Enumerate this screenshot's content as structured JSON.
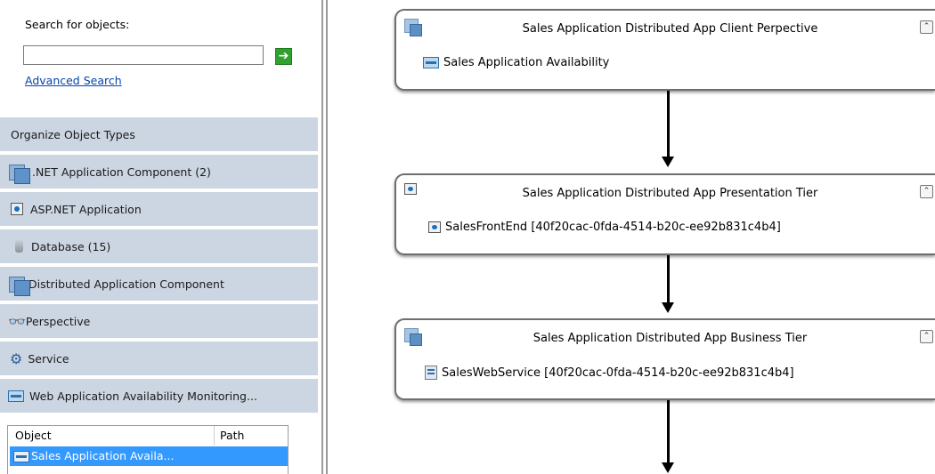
{
  "search": {
    "label": "Search for objects:",
    "value": "",
    "placeholder": "",
    "go_icon": "arrow-right-icon",
    "advanced_link": "Advanced Search"
  },
  "object_types": {
    "header": "Organize Object Types",
    "items": [
      {
        "label": ".NET Application Component (2)",
        "icon": "component-icon"
      },
      {
        "label": "ASP.NET Application",
        "icon": "asp-net-icon"
      },
      {
        "label": "Database (15)",
        "icon": "database-icon"
      },
      {
        "label": "Distributed Application Component",
        "icon": "component-icon"
      },
      {
        "label": "Perspective",
        "icon": "glasses-icon"
      },
      {
        "label": "Service",
        "icon": "service-icon"
      },
      {
        "label": "Web Application Availability Monitoring...",
        "icon": "web-availability-icon"
      }
    ]
  },
  "results": {
    "columns": [
      "Object",
      "Path"
    ],
    "rows": [
      {
        "object": "Sales Application Availa...",
        "path": "",
        "selected": true
      }
    ]
  },
  "diagram": {
    "nodes": [
      {
        "title": "Sales Application Distributed App Client Perpective",
        "child": "Sales Application Availability"
      },
      {
        "title": "Sales Application Distributed App Presentation Tier",
        "child": "SalesFrontEnd  [40f20cac-0fda-4514-b20c-ee92b831c4b4]"
      },
      {
        "title": "Sales Application Distributed App Business Tier",
        "child": "SalesWebService  [40f20cac-0fda-4514-b20c-ee92b831c4b4]"
      }
    ],
    "collapse_icon": "double-chevron-up-icon"
  },
  "colors": {
    "type_item_bg": "#ccd6e2",
    "selected_row": "#3399ff",
    "link": "#0645ad",
    "go_button": "#2ea12e"
  }
}
